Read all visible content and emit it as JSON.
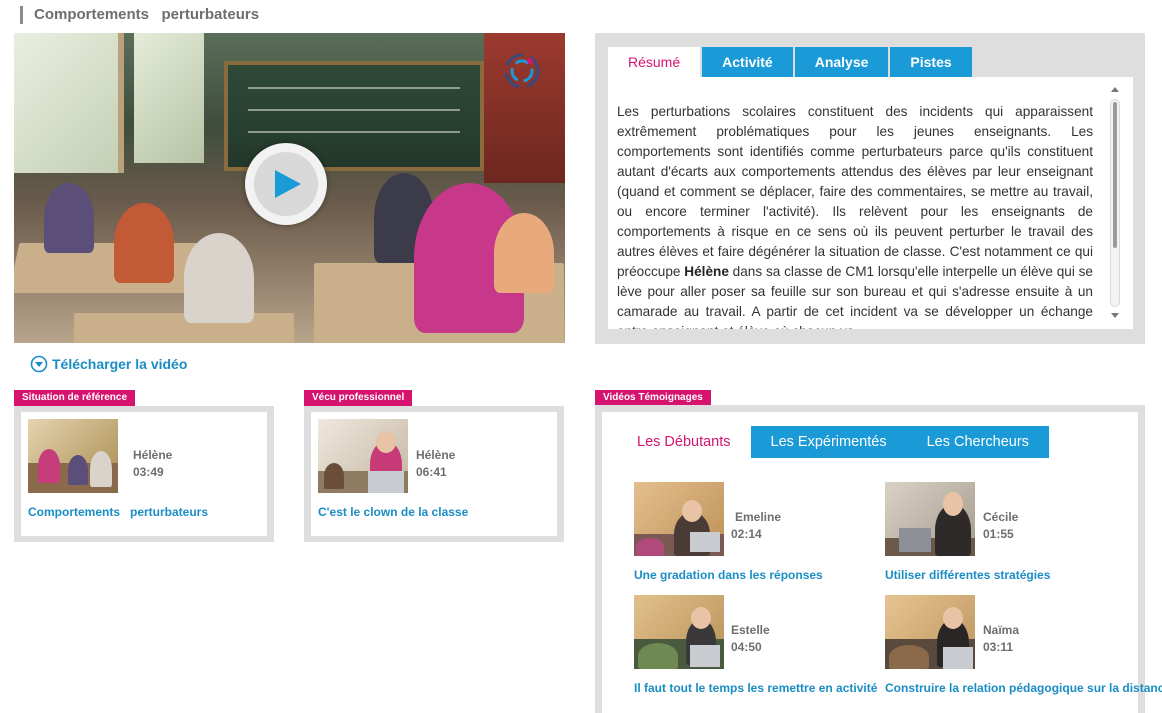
{
  "page": {
    "title": "Comportements   perturbateurs"
  },
  "player": {
    "download_label": "Télécharger la vidéo",
    "play_icon": "play-icon",
    "logo_icon": "circle-logo-icon"
  },
  "summary": {
    "tabs": [
      {
        "label": "Résumé",
        "active": true
      },
      {
        "label": "Activité",
        "active": false
      },
      {
        "label": "Analyse",
        "active": false
      },
      {
        "label": "Pistes",
        "active": false
      }
    ],
    "text_before": "Les perturbations scolaires constituent des incidents qui apparaissent extrêmement problématiques pour les jeunes enseignants. Les comportements sont identifiés comme perturbateurs parce qu'ils constituent autant d'écarts aux comportements attendus des élèves par leur enseignant (quand et comment se déplacer, faire des commentaires, se mettre au travail, ou encore terminer l'activité). Ils relèvent pour les enseignants de comportements à risque en ce sens où ils peuvent perturber le travail des autres élèves et faire dégénérer la situation de classe. C'est notamment ce qui préoccupe ",
    "text_bold": "Hélène",
    "text_after": " dans sa classe de CM1 lorsqu'elle interpelle un élève qui se lève pour aller poser sa feuille sur son bureau et qui s'adresse ensuite à un camarade au travail. A partir de cet incident va se développer un échange entre enseignant et élève où chacun va"
  },
  "reference": {
    "label": "Situation de référence",
    "name": "Hélène",
    "duration": "03:49",
    "title": "Comportements   perturbateurs"
  },
  "professional": {
    "label": "Vécu professionnel",
    "name": "Hélène",
    "duration": "06:41",
    "title": "C'est le clown de la classe"
  },
  "testimonials": {
    "label": "Vidéos Témoignages",
    "tabs": [
      {
        "label": "Les Débutants",
        "active": true
      },
      {
        "label": "Les Expérimentés",
        "active": false
      },
      {
        "label": "Les Chercheurs",
        "active": false
      }
    ],
    "items": [
      {
        "name": "Emeline",
        "duration": "02:14",
        "title": "Une gradation dans les réponses"
      },
      {
        "name": "Cécile",
        "duration": "01:55",
        "title": "Utiliser différentes stratégies"
      },
      {
        "name": "Estelle",
        "duration": "04:50",
        "title": "Il faut tout le temps les remettre en activité"
      },
      {
        "name": "Naïma",
        "duration": "03:11",
        "title": "Construire la relation pédagogique sur la distance"
      }
    ]
  },
  "colors": {
    "accent_blue": "#1a9ad6",
    "accent_pink": "#d6136f",
    "link_blue": "#1a8dc5",
    "panel_gray": "#dedede"
  }
}
